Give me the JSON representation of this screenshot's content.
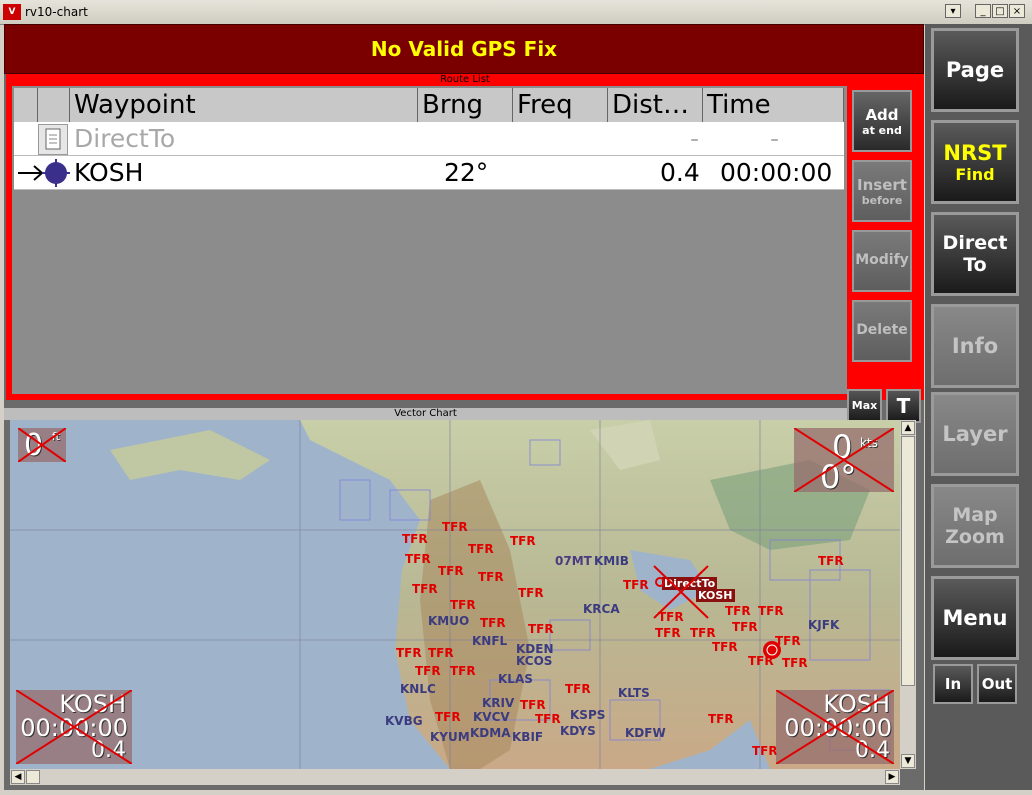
{
  "window": {
    "title": "rv10-chart",
    "app_icon": "V",
    "min": "_",
    "max": "□",
    "close": "×"
  },
  "gps": {
    "status": "No Valid GPS Fix"
  },
  "route_list": {
    "label": "Route List",
    "columns": [
      "Waypoint",
      "Brng",
      "Freq",
      "Dist…",
      "Time"
    ],
    "rows": [
      {
        "waypoint": "DirectTo",
        "brng": "",
        "freq": "",
        "dist": "-",
        "time": "-"
      },
      {
        "waypoint": "KOSH",
        "brng": "22°",
        "freq": "",
        "dist": "0.4",
        "time": "00:00:00"
      }
    ]
  },
  "route_buttons": {
    "add": {
      "line1": "Add",
      "line2": "at end"
    },
    "insert": {
      "line1": "Insert",
      "line2": "before"
    },
    "modify": "Modify",
    "delete": "Delete"
  },
  "chart": {
    "label": "Vector Chart",
    "max_button": "Max",
    "t_button": "T",
    "altitude": "0",
    "altitude_unit": "ft",
    "speed": "0",
    "speed_unit": "kts",
    "heading": "0°",
    "left_box": {
      "waypoint": "KOSH",
      "time": "00:00:00",
      "dist": "0.4"
    },
    "right_box": {
      "waypoint": "KOSH",
      "time": "00:00:00",
      "dist": "0.4"
    },
    "directto_tag": "DirectTo",
    "kosh_tag": "KOSH",
    "tfr": "TFR",
    "airports": [
      "07MT",
      "KMIB",
      "KRCA",
      "KMUO",
      "KNFL",
      "KDEN",
      "KCOS",
      "KLAS",
      "KNLC",
      "KRIV",
      "KVCV",
      "KVBG",
      "KSPS",
      "KLTS",
      "KDYS",
      "KYUM",
      "KDMA",
      "KBIF",
      "KDFW",
      "KJFK"
    ]
  },
  "right_panel": {
    "page": "Page",
    "nrst": "NRST",
    "find": "Find",
    "direct": "Direct",
    "to": "To",
    "info": "Info",
    "layer": "Layer",
    "map": "Map",
    "zoom": "Zoom",
    "menu": "Menu",
    "in": "In",
    "out": "Out"
  },
  "colors": {
    "banner": "#7a0000",
    "gps_text": "#ffff00",
    "tfr": "#e00000",
    "airport": "#3b3b80",
    "nrst": "#ffff00"
  }
}
